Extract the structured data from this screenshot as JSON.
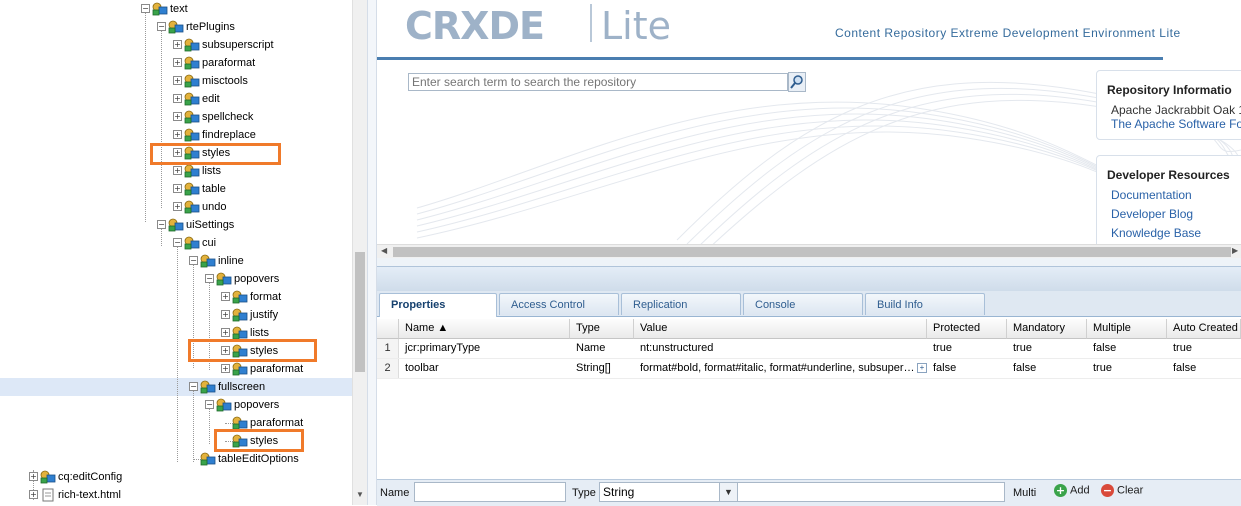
{
  "tree": {
    "nodes": [
      {
        "label": "text"
      },
      {
        "label": "rtePlugins"
      },
      {
        "label": "subsuperscript"
      },
      {
        "label": "paraformat"
      },
      {
        "label": "misctools"
      },
      {
        "label": "edit"
      },
      {
        "label": "spellcheck"
      },
      {
        "label": "findreplace"
      },
      {
        "label": "styles"
      },
      {
        "label": "lists"
      },
      {
        "label": "table"
      },
      {
        "label": "undo"
      },
      {
        "label": "uiSettings"
      },
      {
        "label": "cui"
      },
      {
        "label": "inline"
      },
      {
        "label": "popovers"
      },
      {
        "label": "format"
      },
      {
        "label": "justify"
      },
      {
        "label": "lists"
      },
      {
        "label": "styles"
      },
      {
        "label": "paraformat"
      },
      {
        "label": "fullscreen"
      },
      {
        "label": "popovers"
      },
      {
        "label": "paraformat"
      },
      {
        "label": "styles"
      },
      {
        "label": "tableEditOptions"
      },
      {
        "label": "cq:editConfig"
      },
      {
        "label": "rich-text.html"
      }
    ],
    "toggle_expanded": "−",
    "toggle_collapsed": "+",
    "highlight_color": "#f07a2a",
    "selected_color": "#dde8f7"
  },
  "header": {
    "logo_crxde": "CRXDE",
    "logo_lite": "Lite",
    "tagline": "Content Repository Extreme Development Environment Lite",
    "search_placeholder": "Enter search term to search the repository"
  },
  "repo_box": {
    "title": "Repository Informatio",
    "line1": "Apache Jackrabbit Oak 1",
    "link": "The Apache Software Fo"
  },
  "dev_box": {
    "title": "Developer Resources",
    "links": [
      "Documentation",
      "Developer Blog",
      "Knowledge Base"
    ]
  },
  "tabs": [
    "Properties",
    "Access Control",
    "Replication",
    "Console",
    "Build Info"
  ],
  "grid": {
    "headers": [
      "Name ▲",
      "Type",
      "Value",
      "Protected",
      "Mandatory",
      "Multiple",
      "Auto Created"
    ],
    "rows": [
      {
        "n": "1",
        "name": "jcr:primaryType",
        "type": "Name",
        "value": "nt:unstructured",
        "protected": "true",
        "mandatory": "true",
        "multiple": "false",
        "auto": "true"
      },
      {
        "n": "2",
        "name": "toolbar",
        "type": "String[]",
        "value": "format#bold, format#italic, format#underline, subsuper…",
        "protected": "false",
        "mandatory": "false",
        "multiple": "true",
        "auto": "false"
      }
    ]
  },
  "footer": {
    "name_label": "Name",
    "type_label": "Type",
    "type_value": "String",
    "multi_label": "Multi",
    "add_label": "Add",
    "clear_label": "Clear"
  }
}
